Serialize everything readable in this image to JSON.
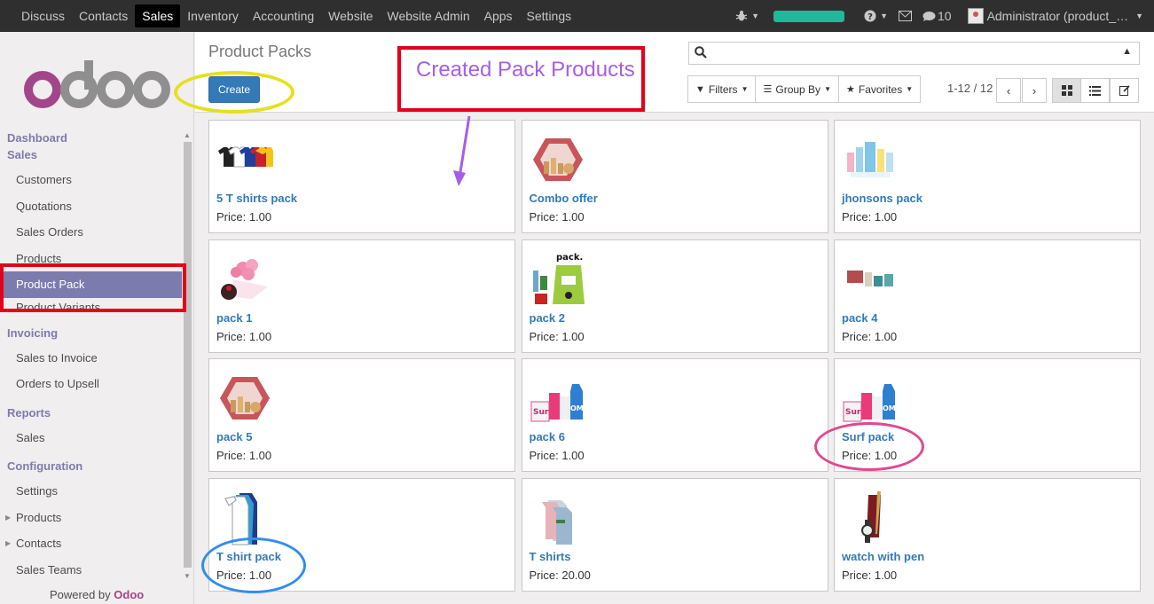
{
  "topbar": {
    "menu": [
      "Discuss",
      "Contacts",
      "Sales",
      "Inventory",
      "Accounting",
      "Website",
      "Website Admin",
      "Apps",
      "Settings"
    ],
    "active_menu": "Sales",
    "messages_count": "10",
    "user_label": "Administrator (product_…",
    "progress": 1.0,
    "progress_color": "#21b799"
  },
  "logo": {
    "text": "odoo"
  },
  "sidebar": {
    "sections": [
      {
        "title": "Dashboard"
      },
      {
        "title": "Sales",
        "items": [
          "Customers",
          "Quotations",
          "Sales Orders",
          "Products",
          "Product Pack",
          "Product Variants"
        ]
      },
      {
        "title": "Invoicing",
        "items": [
          "Sales to Invoice",
          "Orders to Upsell"
        ]
      },
      {
        "title": "Reports",
        "items": [
          "Sales"
        ]
      },
      {
        "title": "Configuration",
        "items": [
          "Settings",
          "Products",
          "Contacts",
          "Sales Teams"
        ]
      }
    ],
    "active_item": "Product Pack",
    "powered_prefix": "Powered by",
    "powered_brand": "Odoo"
  },
  "control_panel": {
    "title": "Product Packs",
    "create_label": "Create",
    "search_value": "",
    "filters_label": "Filters",
    "groupby_label": "Group By",
    "favorites_label": "Favorites",
    "pager": "1-12 / 12"
  },
  "annotation": {
    "callout_text": "Created Pack Products",
    "callout_color": "#a65ee7",
    "rect_color": "#e2001a"
  },
  "products": [
    {
      "name": "5 T shirts pack",
      "price": "Price: 1.00",
      "icon": "tshirts"
    },
    {
      "name": "Combo offer",
      "price": "Price: 1.00",
      "icon": "giftbox"
    },
    {
      "name": "jhonsons pack",
      "price": "Price: 1.00",
      "icon": "babycare"
    },
    {
      "name": "pack 1",
      "price": "Price: 1.00",
      "icon": "flowers"
    },
    {
      "name": "pack 2",
      "price": "Price: 1.00",
      "icon": "bag-pack"
    },
    {
      "name": "pack 4",
      "price": "Price: 1.00",
      "icon": "cosmetics"
    },
    {
      "name": "pack 5",
      "price": "Price: 1.00",
      "icon": "giftbox"
    },
    {
      "name": "pack 6",
      "price": "Price: 1.00",
      "icon": "detergent"
    },
    {
      "name": "Surf pack",
      "price": "Price: 1.00",
      "icon": "detergent"
    },
    {
      "name": "T shirt pack",
      "price": "Price: 1.00",
      "icon": "tshirt-stack"
    },
    {
      "name": "T shirts",
      "price": "Price: 20.00",
      "icon": "shirts-hanging"
    },
    {
      "name": "watch with pen",
      "price": "Price: 1.00",
      "icon": "watch-pen"
    }
  ]
}
